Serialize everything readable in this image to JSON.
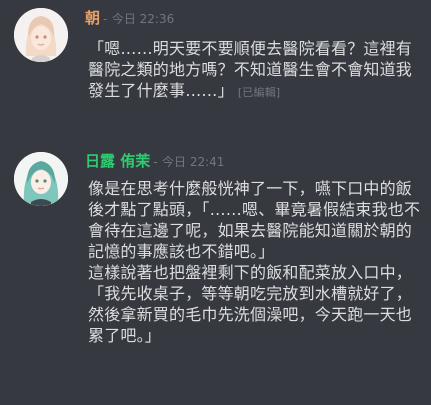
{
  "colors": {
    "background": "#36393f",
    "author1": "#e8a069",
    "author2": "#2ecc71",
    "body_text": "#dcddde",
    "muted": "#72767d"
  },
  "messages": [
    {
      "author": "朝",
      "separator": "-",
      "timestamp": "今日 22:36",
      "text": "「嗯……明天要不要順便去醫院看看？這裡有醫院之類的地方嗎？不知道醫生會不會知道我發生了什麼事……」",
      "edited_label": "[已編輯]",
      "avatar_icon": "white-haired-girl-avatar-icon"
    },
    {
      "author": "日露 侑茉",
      "separator": "-",
      "timestamp": "今日 22:41",
      "paragraphs": [
        "像是在思考什麼般恍神了一下，嚥下口中的飯後才點了點頭，「……嗯、畢竟暑假結束我也不會待在這邊了呢，如果去醫院能知道關於朝的記憶的事應該也不錯吧。」",
        "這樣說著也把盤裡剩下的飯和配菜放入口中，「我先收桌子，等等朝吃完放到水槽就好了，然後拿新買的毛巾先洗個澡吧，今天跑一天也累了吧。」"
      ],
      "avatar_icon": "green-haired-girl-avatar-icon"
    }
  ]
}
